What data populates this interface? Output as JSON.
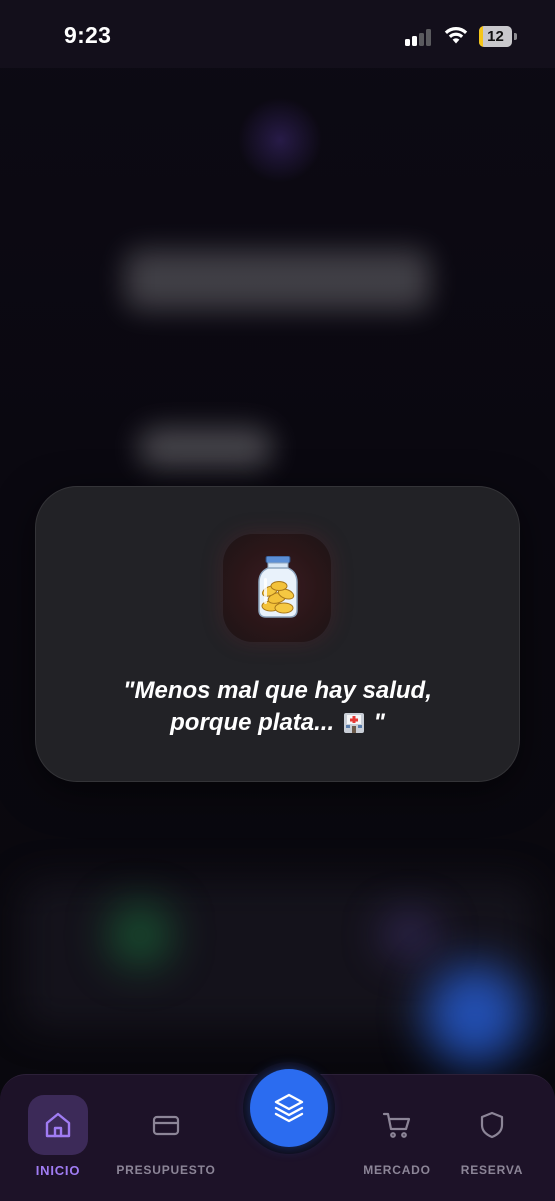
{
  "status_bar": {
    "time": "9:23",
    "battery_level": "12",
    "battery_fraction": 0.12
  },
  "toast": {
    "icon": "coin-jar-icon",
    "message_line1": "\"Menos mal que hay salud,",
    "message_line2": "porque plata...",
    "message_emoji": "hospital-icon",
    "message_end": "\""
  },
  "bottom_nav": {
    "items": [
      {
        "label": "INICIO",
        "icon": "home-icon",
        "active": true
      },
      {
        "label": "PRESUPUESTO",
        "icon": "credit-card-icon",
        "active": false
      },
      {
        "label": "MERCADO",
        "icon": "cart-icon",
        "active": false
      },
      {
        "label": "RESERVA",
        "icon": "shield-icon",
        "active": false
      }
    ],
    "center_action": {
      "icon": "layers-icon"
    }
  },
  "colors": {
    "accent_purple": "#a07cf3",
    "fab_blue": "#2b6cf0",
    "nav_background": "#1d1228",
    "toast_background": "#222226"
  }
}
